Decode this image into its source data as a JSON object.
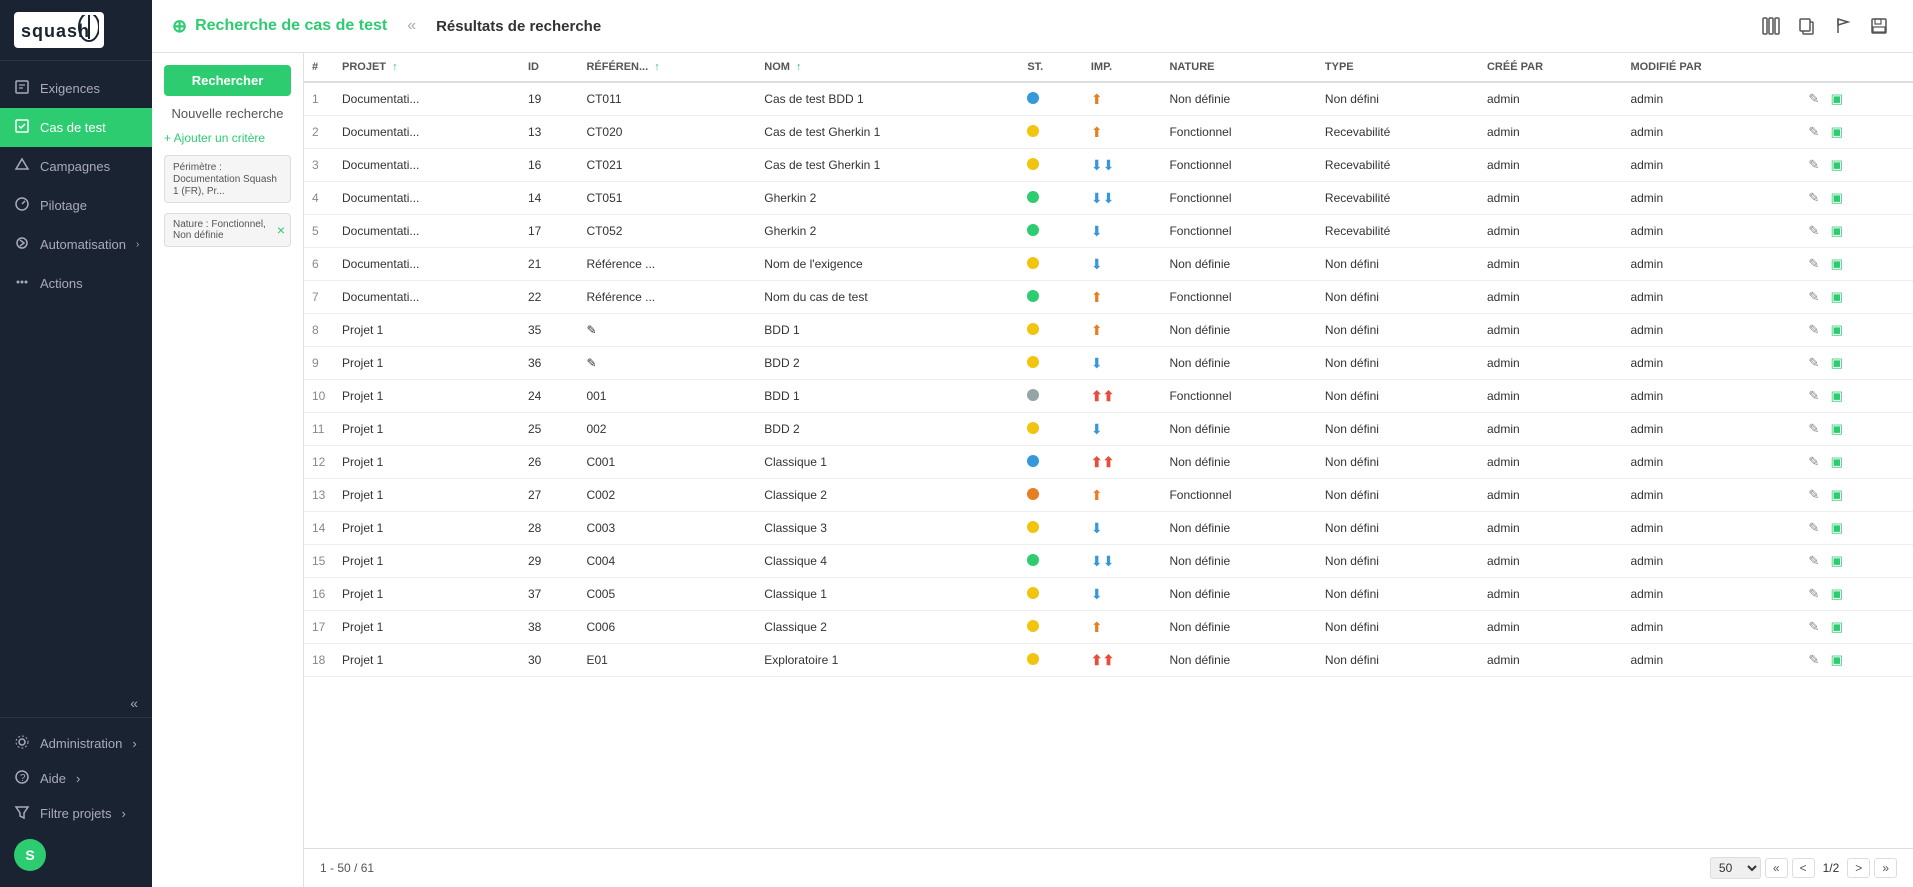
{
  "sidebar": {
    "logo_text": "squash",
    "items": [
      {
        "id": "exigences",
        "label": "Exigences",
        "active": false,
        "has_arrow": false
      },
      {
        "id": "cas-de-test",
        "label": "Cas de test",
        "active": true,
        "has_arrow": false
      },
      {
        "id": "campagnes",
        "label": "Campagnes",
        "active": false,
        "has_arrow": false
      },
      {
        "id": "pilotage",
        "label": "Pilotage",
        "active": false,
        "has_arrow": false
      },
      {
        "id": "automatisation",
        "label": "Automatisation",
        "active": false,
        "has_arrow": true
      },
      {
        "id": "actions",
        "label": "Actions",
        "active": false,
        "has_arrow": false
      }
    ],
    "bottom_items": [
      {
        "id": "administration",
        "label": "Administration",
        "has_arrow": true
      },
      {
        "id": "aide",
        "label": "Aide",
        "has_arrow": true
      },
      {
        "id": "filtre-projets",
        "label": "Filtre projets",
        "has_arrow": true
      }
    ],
    "user_initial": "S",
    "collapse_label": "«"
  },
  "header": {
    "icon": "⊕",
    "title": "Recherche de cas de test",
    "divider": "«",
    "results_title": "Résultats de recherche"
  },
  "left_panel": {
    "search_button": "Rechercher",
    "new_search_link": "Nouvelle recherche",
    "add_criterion": "+ Ajouter un critère",
    "filter1_label": "Périmètre : Documentation Squash 1 (FR), Pr...",
    "filter2_label": "Nature : Fonctionnel, Non définie",
    "filter2_remove": "×"
  },
  "table": {
    "columns": [
      {
        "id": "num",
        "label": "#"
      },
      {
        "id": "projet",
        "label": "PROJET",
        "sortable": true,
        "sort_dir": "asc"
      },
      {
        "id": "id",
        "label": "ID"
      },
      {
        "id": "reference",
        "label": "RÉFÉREN...",
        "sortable": true,
        "sort_dir": "asc"
      },
      {
        "id": "nom",
        "label": "NOM",
        "sortable": true,
        "sort_dir": "asc"
      },
      {
        "id": "statut",
        "label": "ST."
      },
      {
        "id": "importance",
        "label": "IMP."
      },
      {
        "id": "nature",
        "label": "NATURE"
      },
      {
        "id": "type",
        "label": "TYPE"
      },
      {
        "id": "cree_par",
        "label": "CRÉÉ PAR"
      },
      {
        "id": "modifie_par",
        "label": "MODIFIÉ PAR"
      },
      {
        "id": "actions",
        "label": ""
      }
    ],
    "rows": [
      {
        "num": 1,
        "projet": "Documentati...",
        "id": 19,
        "reference": "CT011",
        "nom": "Cas de test BDD 1",
        "statut": "blue",
        "importance": "med-up",
        "nature": "Non définie",
        "type": "Non défini",
        "cree_par": "admin",
        "modifie_par": "admin"
      },
      {
        "num": 2,
        "projet": "Documentati...",
        "id": 13,
        "reference": "CT020",
        "nom": "Cas de test Gherkin 1",
        "statut": "yellow",
        "importance": "med-up",
        "nature": "Fonctionnel",
        "type": "Recevabilité",
        "cree_par": "admin",
        "modifie_par": "admin"
      },
      {
        "num": 3,
        "projet": "Documentati...",
        "id": 16,
        "reference": "CT021",
        "nom": "Cas de test Gherkin 1",
        "statut": "yellow",
        "importance": "low-down",
        "nature": "Fonctionnel",
        "type": "Recevabilité",
        "cree_par": "admin",
        "modifie_par": "admin"
      },
      {
        "num": 4,
        "projet": "Documentati...",
        "id": 14,
        "reference": "CT051",
        "nom": "Gherkin 2",
        "statut": "green",
        "importance": "low-down",
        "nature": "Fonctionnel",
        "type": "Recevabilité",
        "cree_par": "admin",
        "modifie_par": "admin"
      },
      {
        "num": 5,
        "projet": "Documentati...",
        "id": 17,
        "reference": "CT052",
        "nom": "Gherkin 2",
        "statut": "green",
        "importance": "low",
        "nature": "Fonctionnel",
        "type": "Recevabilité",
        "cree_par": "admin",
        "modifie_par": "admin"
      },
      {
        "num": 6,
        "projet": "Documentati...",
        "id": 21,
        "reference": "Référence ...",
        "nom": "Nom de l'exigence",
        "statut": "yellow",
        "importance": "low",
        "nature": "Non définie",
        "type": "Non défini",
        "cree_par": "admin",
        "modifie_par": "admin"
      },
      {
        "num": 7,
        "projet": "Documentati...",
        "id": 22,
        "reference": "Référence ...",
        "nom": "Nom du cas de test",
        "statut": "green",
        "importance": "med-up",
        "nature": "Fonctionnel",
        "type": "Non défini",
        "cree_par": "admin",
        "modifie_par": "admin"
      },
      {
        "num": 8,
        "projet": "Projet 1",
        "id": 35,
        "reference": "✎",
        "nom": "BDD 1",
        "statut": "yellow",
        "importance": "med-up",
        "nature": "Non définie",
        "type": "Non défini",
        "cree_par": "admin",
        "modifie_par": "admin"
      },
      {
        "num": 9,
        "projet": "Projet 1",
        "id": 36,
        "reference": "✎",
        "nom": "BDD 2",
        "statut": "yellow",
        "importance": "low",
        "nature": "Non définie",
        "type": "Non défini",
        "cree_par": "admin",
        "modifie_par": "admin"
      },
      {
        "num": 10,
        "projet": "Projet 1",
        "id": 24,
        "reference": "001",
        "nom": "BDD 1",
        "statut": "gray",
        "importance": "high",
        "nature": "Fonctionnel",
        "type": "Non défini",
        "cree_par": "admin",
        "modifie_par": "admin"
      },
      {
        "num": 11,
        "projet": "Projet 1",
        "id": 25,
        "reference": "002",
        "nom": "BDD 2",
        "statut": "yellow",
        "importance": "low",
        "nature": "Non définie",
        "type": "Non défini",
        "cree_par": "admin",
        "modifie_par": "admin"
      },
      {
        "num": 12,
        "projet": "Projet 1",
        "id": 26,
        "reference": "C001",
        "nom": "Classique 1",
        "statut": "blue",
        "importance": "high",
        "nature": "Non définie",
        "type": "Non défini",
        "cree_par": "admin",
        "modifie_par": "admin"
      },
      {
        "num": 13,
        "projet": "Projet 1",
        "id": 27,
        "reference": "C002",
        "nom": "Classique 2",
        "statut": "orange",
        "importance": "med-up",
        "nature": "Fonctionnel",
        "type": "Non défini",
        "cree_par": "admin",
        "modifie_par": "admin"
      },
      {
        "num": 14,
        "projet": "Projet 1",
        "id": 28,
        "reference": "C003",
        "nom": "Classique 3",
        "statut": "yellow",
        "importance": "low",
        "nature": "Non définie",
        "type": "Non défini",
        "cree_par": "admin",
        "modifie_par": "admin"
      },
      {
        "num": 15,
        "projet": "Projet 1",
        "id": 29,
        "reference": "C004",
        "nom": "Classique 4",
        "statut": "green",
        "importance": "low-down",
        "nature": "Non définie",
        "type": "Non défini",
        "cree_par": "admin",
        "modifie_par": "admin"
      },
      {
        "num": 16,
        "projet": "Projet 1",
        "id": 37,
        "reference": "C005",
        "nom": "Classique 1",
        "statut": "yellow",
        "importance": "low",
        "nature": "Non définie",
        "type": "Non défini",
        "cree_par": "admin",
        "modifie_par": "admin"
      },
      {
        "num": 17,
        "projet": "Projet 1",
        "id": 38,
        "reference": "C006",
        "nom": "Classique 2",
        "statut": "yellow",
        "importance": "med-up",
        "nature": "Non définie",
        "type": "Non défini",
        "cree_par": "admin",
        "modifie_par": "admin"
      },
      {
        "num": 18,
        "projet": "Projet 1",
        "id": 30,
        "reference": "E01",
        "nom": "Exploratoire 1",
        "statut": "yellow",
        "importance": "high",
        "nature": "Non définie",
        "type": "Non défini",
        "cree_par": "admin",
        "modifie_par": "admin"
      }
    ]
  },
  "pagination": {
    "info": "1 - 50 / 61",
    "page_size": "50",
    "first_label": "«",
    "prev_label": "<",
    "current_page": "1/2",
    "next_label": ">",
    "last_label": "»"
  }
}
